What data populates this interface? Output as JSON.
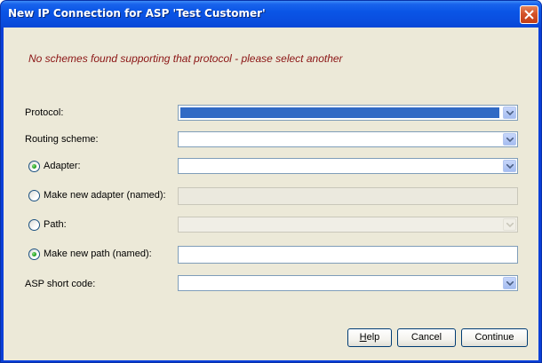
{
  "window": {
    "title": "New IP Connection for ASP 'Test Customer'"
  },
  "error_message": "No schemes found supporting that protocol - please select another",
  "form": {
    "protocol_label": "Protocol:",
    "routing_label": "Routing scheme:",
    "adapter_label": "Adapter:",
    "new_adapter_label": "Make new adapter (named):",
    "path_label": "Path:",
    "new_path_label": "Make new path (named):",
    "asp_short_code_label": "ASP short code:"
  },
  "buttons": {
    "help_first": "H",
    "help_rest": "elp",
    "cancel": "Cancel",
    "continue": "Continue"
  },
  "icons": {
    "close": "close-icon",
    "dropdown": "chevron-down-icon",
    "radio_checked": "radio-checked-icon"
  },
  "colors": {
    "error_text": "#8b1414",
    "titlebar": "#0a55e6",
    "selection": "#316ac5",
    "dialog_bg": "#ece9d8"
  }
}
